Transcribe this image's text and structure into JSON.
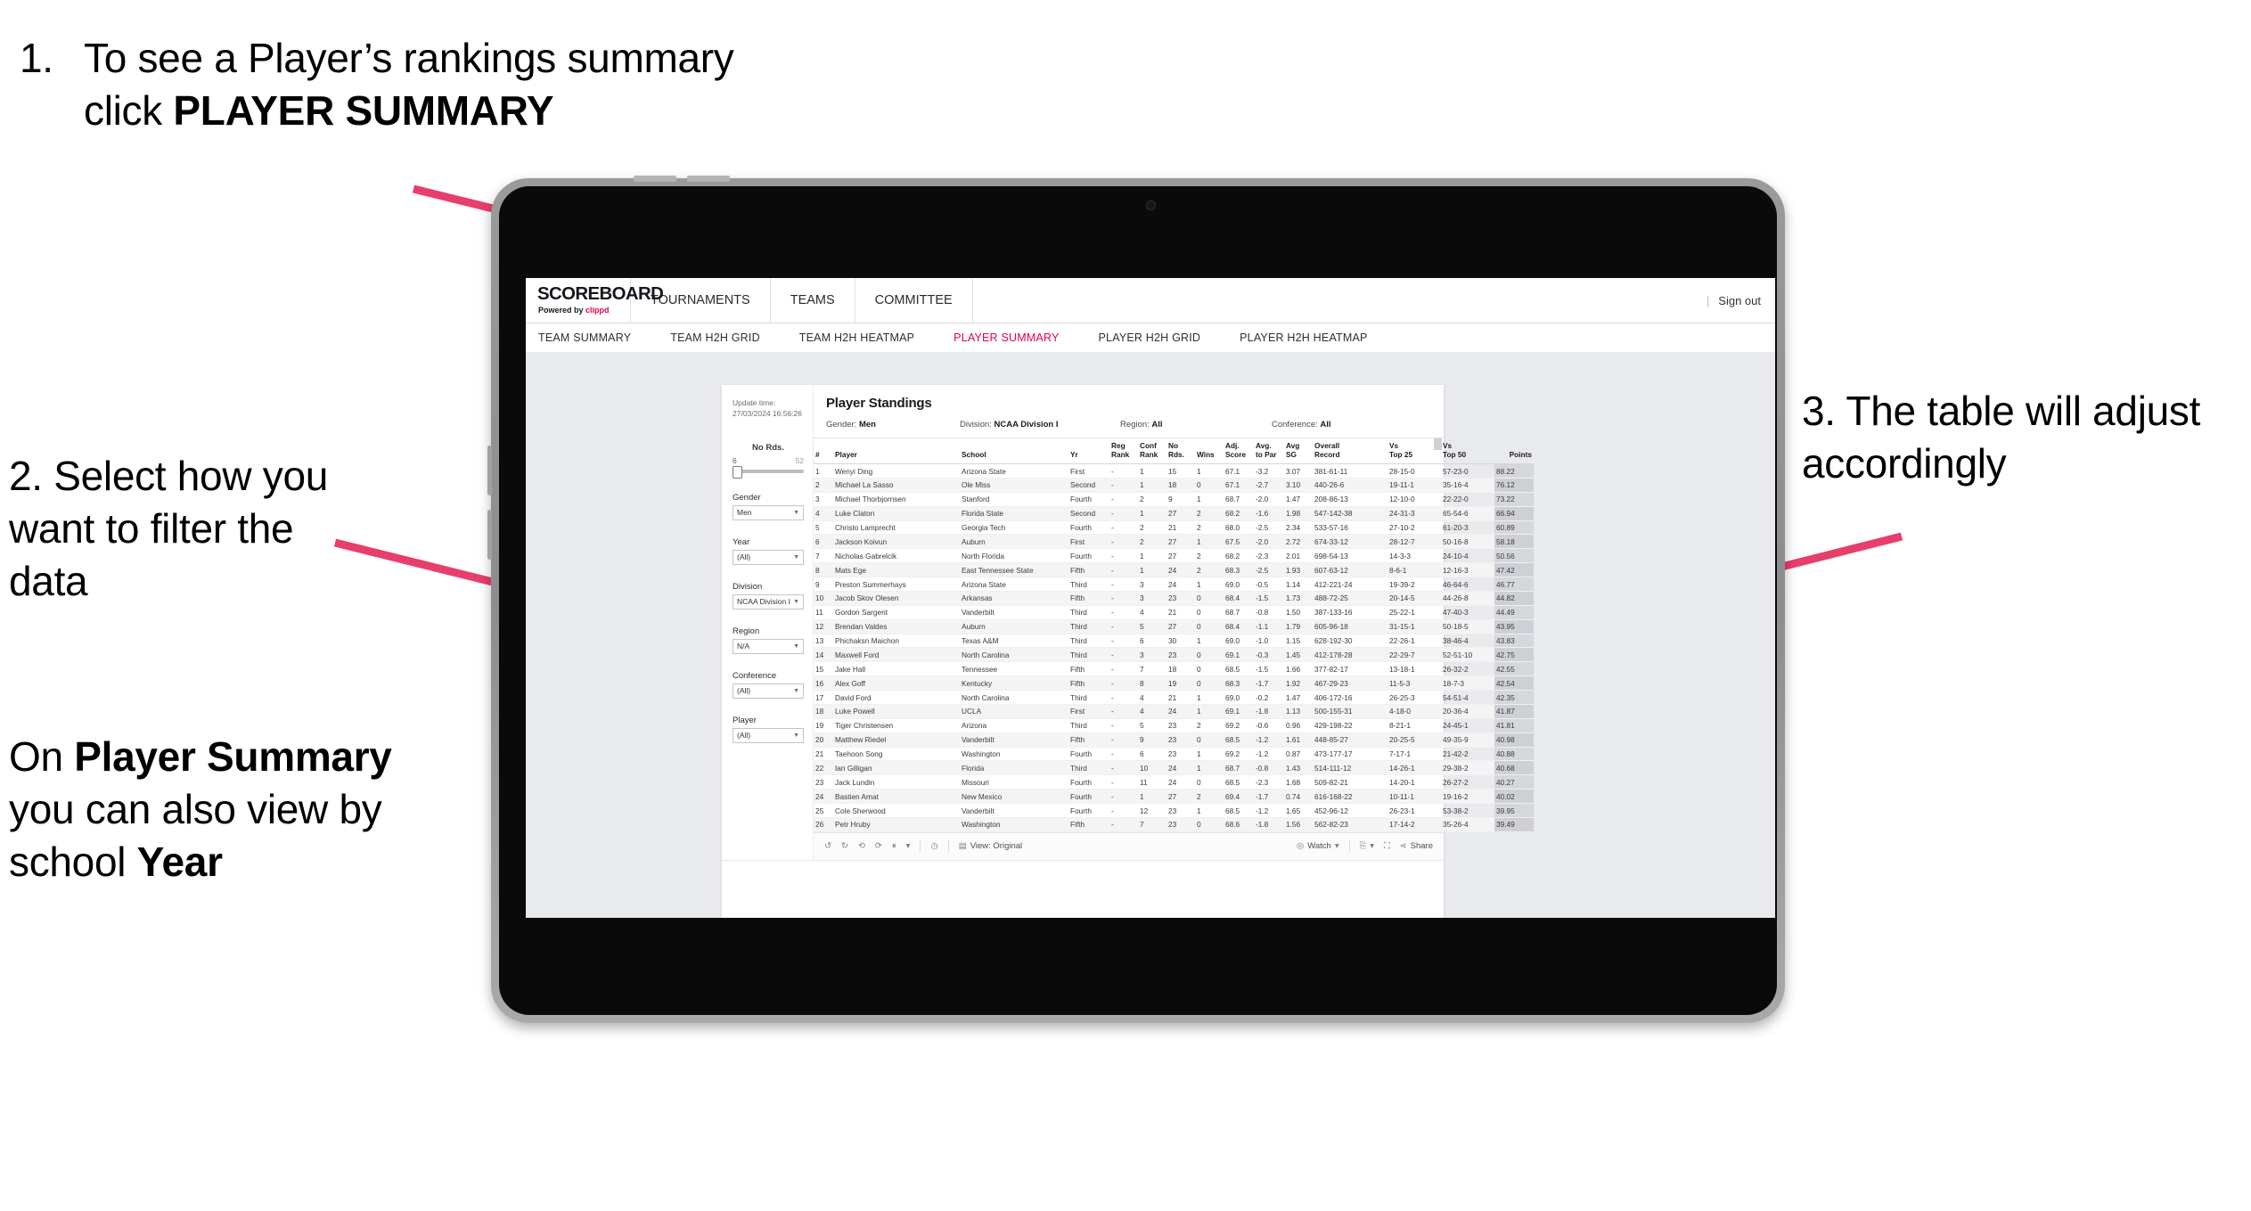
{
  "annotations": {
    "step1": {
      "number": "1.",
      "text_before": "To see a Player’s rankings summary click ",
      "bold": "PLAYER SUMMARY"
    },
    "step2": {
      "text": "2. Select how you want to filter the data"
    },
    "step3": {
      "text": "3. The table will adjust accordingly"
    },
    "step4": {
      "pre": "On ",
      "bold1": "Player Summary",
      "mid": " you can also view by school ",
      "bold2": "Year"
    }
  },
  "app": {
    "brand": {
      "name": "SCOREBOARD",
      "powered_prefix": "Powered by ",
      "powered_brand": "clippd",
      "accent": "#e4004c"
    },
    "top_nav": [
      "TOURNAMENTS",
      "TEAMS",
      "COMMITTEE"
    ],
    "account": {
      "divider": "|",
      "sign_out": "Sign out"
    },
    "sub_nav": {
      "tabs": [
        "TEAM SUMMARY",
        "TEAM H2H GRID",
        "TEAM H2H HEATMAP",
        "PLAYER SUMMARY",
        "PLAYER H2H GRID",
        "PLAYER H2H HEATMAP"
      ],
      "active": "PLAYER SUMMARY"
    },
    "filters": {
      "update_label": "Update time:",
      "update_time": "27/03/2024 16:56:26",
      "slider": {
        "label": "No Rds.",
        "min": "6",
        "max": "52"
      },
      "controls": [
        {
          "label": "Gender",
          "value": "Men"
        },
        {
          "label": "Year",
          "value": "(All)"
        },
        {
          "label": "Division",
          "value": "NCAA Division I"
        },
        {
          "label": "Region",
          "value": "N/A"
        },
        {
          "label": "Conference",
          "value": "(All)"
        },
        {
          "label": "Player",
          "value": "(All)"
        }
      ]
    },
    "panel": {
      "title": "Player Standings",
      "meta": [
        {
          "label": "Gender: ",
          "value": "Men"
        },
        {
          "label": "Division: ",
          "value": "NCAA Division I"
        },
        {
          "label": "Region: ",
          "value": "All"
        },
        {
          "label": "Conference: ",
          "value": "All"
        }
      ]
    },
    "footer": {
      "view_label": "View: Original",
      "watch_label": "Watch",
      "share_label": "Share"
    }
  },
  "chart_data": {
    "type": "table",
    "title": "Player Standings",
    "columns": [
      "#",
      "Player",
      "School",
      "Yr",
      "Reg Rank",
      "Conf Rank",
      "No Rds.",
      "Wins",
      "Adj. Score",
      "Avg. to Par",
      "Avg SG",
      "Overall Record",
      "Vs Top 25",
      "Vs Top 50",
      "Points"
    ],
    "rows": [
      [
        "1",
        "Wenyi Ding",
        "Arizona State",
        "First",
        "-",
        "1",
        "15",
        "1",
        "67.1",
        "-3.2",
        "3.07",
        "381-61-11",
        "28-15-0",
        "57-23-0",
        "88.22"
      ],
      [
        "2",
        "Michael La Sasso",
        "Ole Miss",
        "Second",
        "-",
        "1",
        "18",
        "0",
        "67.1",
        "-2.7",
        "3.10",
        "440-26-6",
        "19-11-1",
        "35-16-4",
        "76.12"
      ],
      [
        "3",
        "Michael Thorbjornsen",
        "Stanford",
        "Fourth",
        "-",
        "2",
        "9",
        "1",
        "68.7",
        "-2.0",
        "1.47",
        "208-86-13",
        "12-10-0",
        "22-22-0",
        "73.22"
      ],
      [
        "4",
        "Luke Claton",
        "Florida State",
        "Second",
        "-",
        "1",
        "27",
        "2",
        "68.2",
        "-1.6",
        "1.98",
        "547-142-38",
        "24-31-3",
        "65-54-6",
        "66.94"
      ],
      [
        "5",
        "Christo Lamprecht",
        "Georgia Tech",
        "Fourth",
        "-",
        "2",
        "21",
        "2",
        "68.0",
        "-2.5",
        "2.34",
        "533-57-16",
        "27-10-2",
        "61-20-3",
        "60.89"
      ],
      [
        "6",
        "Jackson Koivun",
        "Auburn",
        "First",
        "-",
        "2",
        "27",
        "1",
        "67.5",
        "-2.0",
        "2.72",
        "674-33-12",
        "28-12-7",
        "50-16-8",
        "58.18"
      ],
      [
        "7",
        "Nicholas Gabrelcik",
        "North Florida",
        "Fourth",
        "-",
        "1",
        "27",
        "2",
        "68.2",
        "-2.3",
        "2.01",
        "698-54-13",
        "14-3-3",
        "24-10-4",
        "50.56"
      ],
      [
        "8",
        "Mats Ege",
        "East Tennessee State",
        "Fifth",
        "-",
        "1",
        "24",
        "2",
        "68.3",
        "-2.5",
        "1.93",
        "607-63-12",
        "8-6-1",
        "12-16-3",
        "47.42"
      ],
      [
        "9",
        "Preston Summerhays",
        "Arizona State",
        "Third",
        "-",
        "3",
        "24",
        "1",
        "69.0",
        "-0.5",
        "1.14",
        "412-221-24",
        "19-39-2",
        "46-64-6",
        "46.77"
      ],
      [
        "10",
        "Jacob Skov Olesen",
        "Arkansas",
        "Fifth",
        "-",
        "3",
        "23",
        "0",
        "68.4",
        "-1.5",
        "1.73",
        "488-72-25",
        "20-14-5",
        "44-26-8",
        "44.82"
      ],
      [
        "11",
        "Gordon Sargent",
        "Vanderbilt",
        "Third",
        "-",
        "4",
        "21",
        "0",
        "68.7",
        "-0.8",
        "1.50",
        "387-133-16",
        "25-22-1",
        "47-40-3",
        "44.49"
      ],
      [
        "12",
        "Brendan Valdes",
        "Auburn",
        "Third",
        "-",
        "5",
        "27",
        "0",
        "68.4",
        "-1.1",
        "1.79",
        "605-96-18",
        "31-15-1",
        "50-18-5",
        "43.95"
      ],
      [
        "13",
        "Phichaksn Maichon",
        "Texas A&M",
        "Third",
        "-",
        "6",
        "30",
        "1",
        "69.0",
        "-1.0",
        "1.15",
        "628-192-30",
        "22-26-1",
        "38-46-4",
        "43.83"
      ],
      [
        "14",
        "Maxwell Ford",
        "North Carolina",
        "Third",
        "-",
        "3",
        "23",
        "0",
        "69.1",
        "-0.3",
        "1.45",
        "412-178-28",
        "22-29-7",
        "52-51-10",
        "42.75"
      ],
      [
        "15",
        "Jake Hall",
        "Tennessee",
        "Fifth",
        "-",
        "7",
        "18",
        "0",
        "68.5",
        "-1.5",
        "1.66",
        "377-82-17",
        "13-18-1",
        "26-32-2",
        "42.55"
      ],
      [
        "16",
        "Alex Goff",
        "Kentucky",
        "Fifth",
        "-",
        "8",
        "19",
        "0",
        "68.3",
        "-1.7",
        "1.92",
        "467-29-23",
        "11-5-3",
        "18-7-3",
        "42.54"
      ],
      [
        "17",
        "David Ford",
        "North Carolina",
        "Third",
        "-",
        "4",
        "21",
        "1",
        "69.0",
        "-0.2",
        "1.47",
        "406-172-16",
        "26-25-3",
        "54-51-4",
        "42.35"
      ],
      [
        "18",
        "Luke Powell",
        "UCLA",
        "First",
        "-",
        "4",
        "24",
        "1",
        "69.1",
        "-1.8",
        "1.13",
        "500-155-31",
        "4-18-0",
        "20-36-4",
        "41.87"
      ],
      [
        "19",
        "Tiger Christensen",
        "Arizona",
        "Third",
        "-",
        "5",
        "23",
        "2",
        "69.2",
        "-0.6",
        "0.96",
        "429-198-22",
        "8-21-1",
        "24-45-1",
        "41.81"
      ],
      [
        "20",
        "Matthew Riedel",
        "Vanderbilt",
        "Fifth",
        "-",
        "9",
        "23",
        "0",
        "68.5",
        "-1.2",
        "1.61",
        "448-85-27",
        "20-25-5",
        "49-35-9",
        "40.98"
      ],
      [
        "21",
        "Taehoon Song",
        "Washington",
        "Fourth",
        "-",
        "6",
        "23",
        "1",
        "69.2",
        "-1.2",
        "0.87",
        "473-177-17",
        "7-17-1",
        "21-42-2",
        "40.88"
      ],
      [
        "22",
        "Ian Gilligan",
        "Florida",
        "Third",
        "-",
        "10",
        "24",
        "1",
        "68.7",
        "-0.8",
        "1.43",
        "514-111-12",
        "14-26-1",
        "29-38-2",
        "40.68"
      ],
      [
        "23",
        "Jack Lundin",
        "Missouri",
        "Fourth",
        "-",
        "11",
        "24",
        "0",
        "68.5",
        "-2.3",
        "1.68",
        "509-82-21",
        "14-20-1",
        "26-27-2",
        "40.27"
      ],
      [
        "24",
        "Bastien Amat",
        "New Mexico",
        "Fourth",
        "-",
        "1",
        "27",
        "2",
        "69.4",
        "-1.7",
        "0.74",
        "616-168-22",
        "10-11-1",
        "19-16-2",
        "40.02"
      ],
      [
        "25",
        "Cole Sherwood",
        "Vanderbilt",
        "Fourth",
        "-",
        "12",
        "23",
        "1",
        "68.5",
        "-1.2",
        "1.65",
        "452-96-12",
        "26-23-1",
        "53-38-2",
        "39.95"
      ],
      [
        "26",
        "Petr Hruby",
        "Washington",
        "Fifth",
        "-",
        "7",
        "23",
        "0",
        "68.6",
        "-1.8",
        "1.56",
        "562-82-23",
        "17-14-2",
        "35-26-4",
        "39.49"
      ]
    ]
  }
}
